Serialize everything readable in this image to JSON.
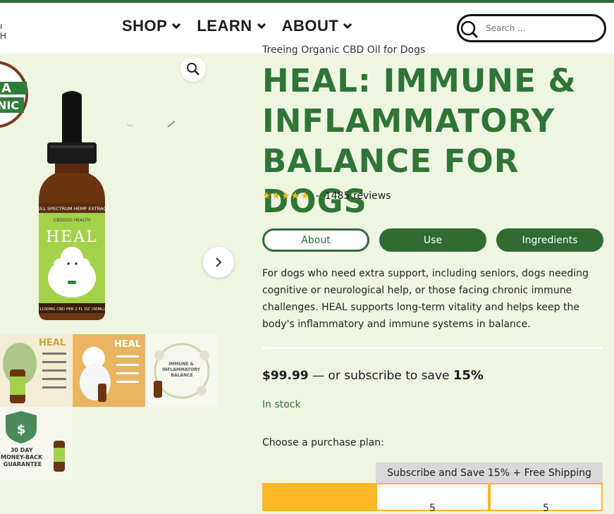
{
  "header": {
    "logo_fragment": "",
    "nav": [
      {
        "label": "SHOP"
      },
      {
        "label": "LEARN"
      },
      {
        "label": "ABOUT"
      }
    ],
    "search": {
      "placeholder": "Search ..."
    }
  },
  "gallery": {
    "organic_badge_text": "A",
    "organic_badge_text2": "NIC",
    "bottle_label_band": "FULL SPECTRUM HEMP EXTRACT",
    "bottle_brand": "CBDDOG HEALTH",
    "bottle_name": "HEAL",
    "bottle_footer": "1100MG CBD PER 1 FL OZ (30ML)",
    "thumbs": [
      {
        "title": "HEAL"
      },
      {
        "title": "HEAL"
      },
      {
        "title": "IMMUNE & INFLAMMATORY BALANCE"
      },
      {
        "title": "30 DAY MONEY-BACK GUARANTEE"
      }
    ]
  },
  "product": {
    "breadcrumb": "Treeing Organic CBD Oil for Dogs",
    "title": "HEAL: IMMUNE & INFLAMMATORY BALANCE FOR DOGS",
    "stars": "★★★★★",
    "rating_sep": "-",
    "reviews": "1485 reviews",
    "tabs": [
      {
        "label": "About",
        "active": true
      },
      {
        "label": "Use",
        "active": false
      },
      {
        "label": "Ingredients",
        "active": false
      }
    ],
    "description": "For dogs who need extra support, including seniors, dogs needing cognitive or neurological help, or those facing chronic immune challenges. HEAL supports long-term vitality and helps keep the body's inflammatory and immune systems in balance.",
    "price": "$99.99",
    "subscribe_text": " — or subscribe to save ",
    "subscribe_pct": "15%",
    "stock": "In stock",
    "plan_label": "Choose a purchase plan:",
    "subscribe_banner": "Subscribe and Save 15% + Free Shipping",
    "plan_digits": [
      "5",
      "5"
    ]
  },
  "colors": {
    "brand_green": "#2f6b32",
    "title_green": "#2f7535",
    "page_bg": "#eef6e2",
    "accent_yellow": "#fbb726"
  }
}
